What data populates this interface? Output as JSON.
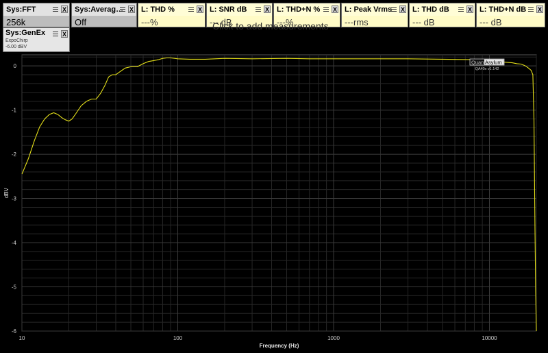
{
  "tiles": [
    {
      "kind": "sys",
      "title": "Sys:FFT",
      "value": "256k"
    },
    {
      "kind": "sys",
      "title": "Sys:Averag…",
      "value": "Off"
    },
    {
      "kind": "meas",
      "title": "L: THD %",
      "value": "---%"
    },
    {
      "kind": "meas",
      "title": "L: SNR dB",
      "value": "--- dB"
    },
    {
      "kind": "meas",
      "title": "L: THD+N %",
      "value": "---%"
    },
    {
      "kind": "meas",
      "title": "L: Peak Vrms",
      "value": "---rms"
    },
    {
      "kind": "meas",
      "title": "L: THD dB",
      "value": "--- dB"
    },
    {
      "kind": "meas",
      "title": "L: THD+N dB",
      "value": "--- dB"
    }
  ],
  "genex": {
    "title": "Sys:GenEx",
    "line1": "ExpoChirp",
    "line2": "-6.00 dBV"
  },
  "hint": "Click to add measurements",
  "logo": {
    "word1": "Quant",
    "word2": "Asylum",
    "version": "QA40x v1.142"
  },
  "icons": {
    "menu": "menu-icon",
    "close": "close-icon"
  },
  "controls": {
    "close_glyph": "X"
  },
  "chart_data": {
    "type": "line",
    "xscale": "log",
    "xlabel": "Frequency (Hz)",
    "ylabel": "dBV",
    "xlim": [
      10,
      20000
    ],
    "ylim": [
      -6,
      0.25
    ],
    "xticks": [
      {
        "v": 10,
        "label": "10"
      },
      {
        "v": 100,
        "label": "100"
      },
      {
        "v": 1000,
        "label": "1000"
      },
      {
        "v": 10000,
        "label": "10000"
      }
    ],
    "yticks": [
      0,
      -1,
      -2,
      -3,
      -4,
      -5,
      -6
    ],
    "grid": true,
    "colors": {
      "line": "#e5e01a",
      "grid": "#3a3a3a",
      "grid_minor": "#262626",
      "axis_text": "#cfcfcf",
      "frame": "#555555"
    },
    "series": [
      {
        "x": [
          10,
          11,
          12,
          13,
          14,
          15,
          16,
          17,
          18,
          19,
          20,
          21,
          22,
          24,
          26,
          28,
          30,
          32,
          34,
          36,
          38,
          40,
          43,
          46,
          50,
          55,
          60,
          65,
          70,
          75,
          80,
          85,
          90,
          100,
          120,
          150,
          200,
          300,
          500,
          700,
          1000,
          2000,
          3000,
          5000,
          8000,
          10000,
          12000,
          14000,
          15000,
          16000,
          17000,
          17800,
          18500,
          19000,
          19300,
          19600,
          19800,
          20000
        ],
        "y": [
          -2.45,
          -2.1,
          -1.7,
          -1.38,
          -1.2,
          -1.1,
          -1.06,
          -1.1,
          -1.17,
          -1.22,
          -1.25,
          -1.2,
          -1.1,
          -0.9,
          -0.8,
          -0.75,
          -0.75,
          -0.62,
          -0.45,
          -0.25,
          -0.2,
          -0.2,
          -0.12,
          -0.05,
          -0.02,
          -0.02,
          0.05,
          0.1,
          0.12,
          0.14,
          0.17,
          0.18,
          0.18,
          0.16,
          0.15,
          0.15,
          0.17,
          0.16,
          0.17,
          0.16,
          0.16,
          0.16,
          0.16,
          0.15,
          0.14,
          0.1,
          0.09,
          0.07,
          0.05,
          0.04,
          0.0,
          -0.05,
          -0.1,
          -0.2,
          -1.2,
          -3.7,
          -5.1,
          -6.0
        ]
      }
    ]
  }
}
